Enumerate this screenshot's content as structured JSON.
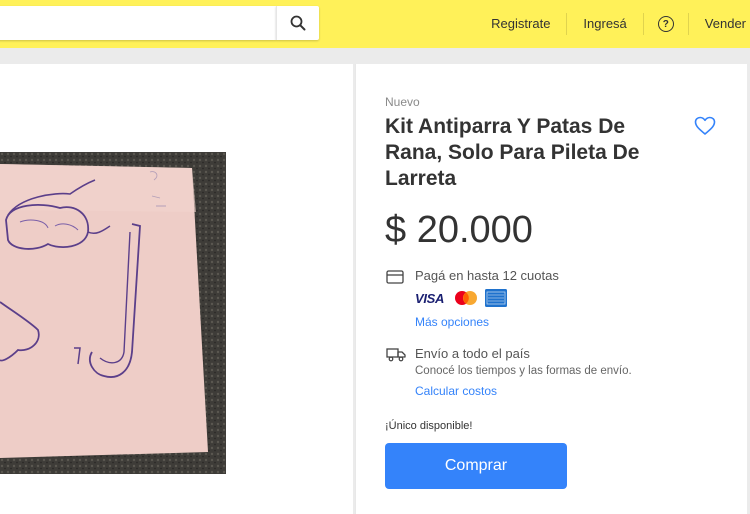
{
  "header": {
    "search_placeholder": "",
    "nav": {
      "register": "Registrate",
      "login": "Ingresá",
      "help": "?",
      "sell": "Vender"
    }
  },
  "product": {
    "condition": "Nuevo",
    "title": "Kit Antiparra Y Patas De Rana, Solo Para Pileta De Larreta",
    "price": "$ 20.000",
    "installments": "Pagá en hasta 12 cuotas",
    "payment_methods": [
      "VISA",
      "mastercard",
      "amex"
    ],
    "more_options": "Más opciones",
    "shipping_title": "Envío a todo el país",
    "shipping_subtitle": "Conocé los tiempos y las formas de envío.",
    "calculate_costs": "Calcular costos",
    "stock": "¡Único disponible!",
    "buy_label": "Comprar"
  },
  "colors": {
    "header_bg": "#fff159",
    "accent_blue": "#3483fa",
    "page_bg": "#ebebeb"
  }
}
